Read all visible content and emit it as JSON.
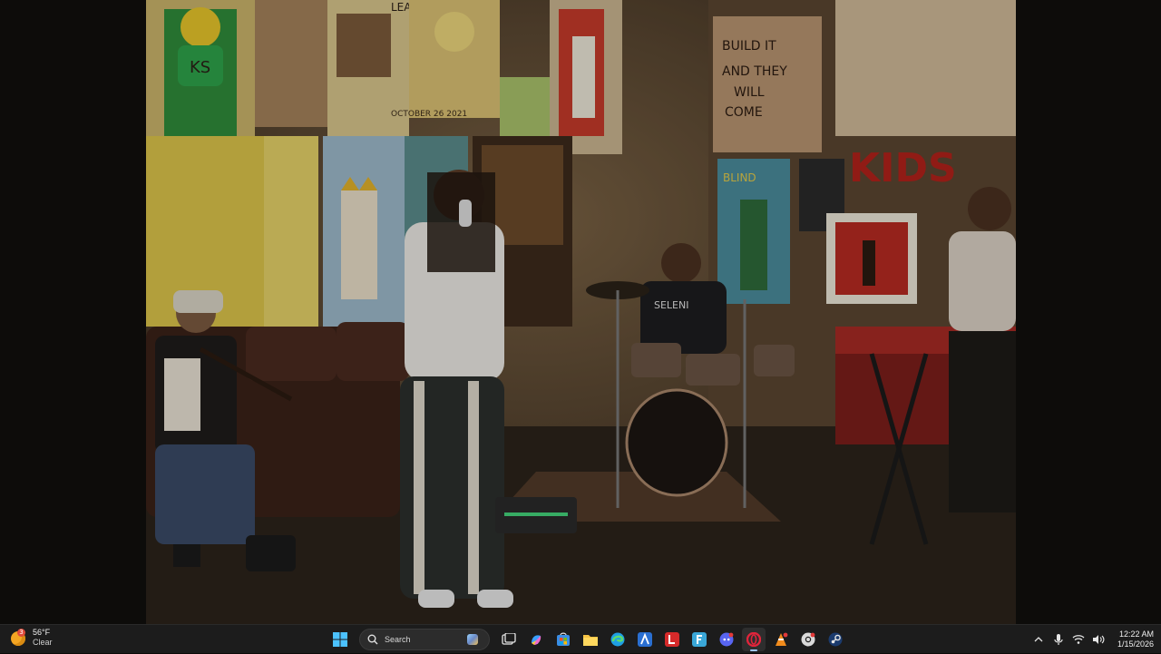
{
  "video": {
    "wall_sign": [
      "BUILD IT",
      "AND THEY",
      "WILL",
      "COME"
    ],
    "poster_top": "LEADER",
    "poster_date": "OCTOBER 26 2021",
    "wall_kids": "KIDS",
    "poster_blind": "BLIND",
    "shirt_text": "SELENI",
    "badge_ks": "KS"
  },
  "taskbar": {
    "weather": {
      "temp": "56°F",
      "condition": "Clear",
      "badge": "3"
    },
    "search": {
      "placeholder": "Search"
    },
    "pinned": [
      {
        "name": "task-view",
        "label": "Task View"
      },
      {
        "name": "copilot",
        "label": "Copilot"
      },
      {
        "name": "microsoft-store",
        "label": "Microsoft Store"
      },
      {
        "name": "file-explorer",
        "label": "File Explorer"
      },
      {
        "name": "edge",
        "label": "Microsoft Edge"
      },
      {
        "name": "app-a",
        "label": "App"
      },
      {
        "name": "app-l",
        "label": "L"
      },
      {
        "name": "app-f",
        "label": "F"
      },
      {
        "name": "discord",
        "label": "Discord"
      },
      {
        "name": "opera",
        "label": "Opera"
      },
      {
        "name": "app-vlc",
        "label": "VLC"
      },
      {
        "name": "app-chrome",
        "label": "Chrome"
      },
      {
        "name": "steam",
        "label": "Steam"
      }
    ],
    "clock": {
      "time": "12:22 AM",
      "date": "1/15/2026"
    }
  },
  "colors": {
    "taskbar_bg": "#1c1c1c",
    "accent": "#9fc7ff",
    "weather_icon": "#f5a623"
  }
}
